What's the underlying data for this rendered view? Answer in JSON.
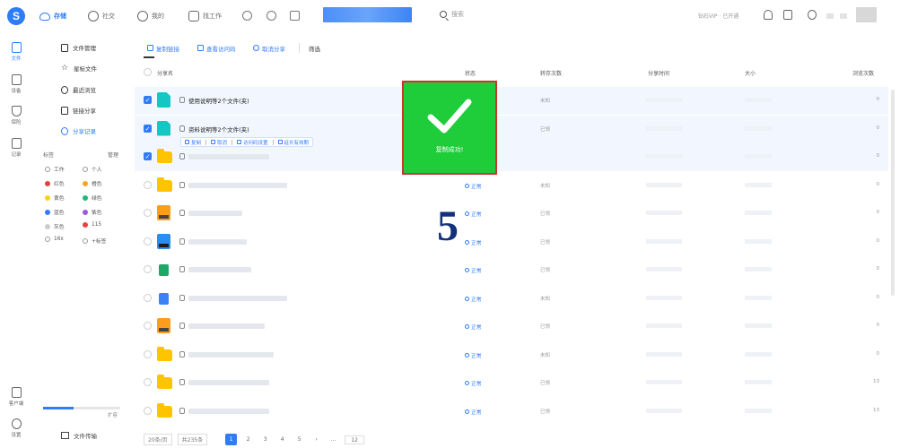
{
  "app": {
    "logo": "S",
    "nav": [
      {
        "label": "存储",
        "icon": "cloud-icon",
        "active": true
      },
      {
        "label": "社交",
        "icon": "clock-icon",
        "active": false
      },
      {
        "label": "我的",
        "icon": "heart-icon",
        "active": false
      },
      {
        "label": "找工作",
        "icon": "briefcase-icon",
        "active": false
      }
    ],
    "search_placeholder": "搜索",
    "vip_text": "钻石VIP · 已开通"
  },
  "rail": [
    {
      "label": "文件",
      "icon": "file-icon",
      "active": true
    },
    {
      "label": "设备",
      "icon": "device-icon",
      "active": false
    },
    {
      "label": "保险",
      "icon": "shield-icon",
      "active": false
    },
    {
      "label": "记录",
      "icon": "pen-icon",
      "active": false
    },
    {
      "label": "客户端",
      "icon": "download-icon",
      "active": false
    },
    {
      "label": "设置",
      "icon": "settings-icon",
      "active": false
    }
  ],
  "sidebar": {
    "items": [
      {
        "label": "文件管理",
        "icon": "file-manage-icon",
        "active": false
      },
      {
        "label": "星标文件",
        "icon": "star-icon",
        "active": false
      },
      {
        "label": "最近浏览",
        "icon": "clock-icon",
        "active": false
      },
      {
        "label": "链接分享",
        "icon": "share-icon",
        "active": false
      },
      {
        "label": "分享记录",
        "icon": "link-icon",
        "active": true
      }
    ],
    "tags_title": "标签",
    "tags_manage": "管理",
    "tags": [
      {
        "label": "工作",
        "color": "#999999",
        "hollow": true
      },
      {
        "label": "个人",
        "color": "#999999",
        "hollow": true
      },
      {
        "label": "红色",
        "color": "#e64340"
      },
      {
        "label": "橙色",
        "color": "#f5a623"
      },
      {
        "label": "黄色",
        "color": "#f8d21a"
      },
      {
        "label": "绿色",
        "color": "#1db977"
      },
      {
        "label": "蓝色",
        "color": "#2f7cf6"
      },
      {
        "label": "紫色",
        "color": "#9b59e0"
      },
      {
        "label": "灰色",
        "color": "#cccccc"
      },
      {
        "label": "115",
        "color": "#e64340"
      },
      {
        "label": "16x",
        "color": "#cccccc",
        "hollow": true
      },
      {
        "label": "+标签",
        "color": "#cccccc",
        "hollow": true
      }
    ],
    "storage_percent": 40,
    "storage_text": "扩容",
    "transfer": "文件传输"
  },
  "toolbar": {
    "buttons": [
      {
        "label": "复制链接",
        "icon": "copy-icon"
      },
      {
        "label": "查看访问码",
        "icon": "eye-icon"
      },
      {
        "label": "取消分享",
        "icon": "cancel-icon"
      },
      {
        "label": "筛选",
        "icon": "filter-icon"
      }
    ]
  },
  "table": {
    "headers": [
      "分享名",
      "状态",
      "转存次数",
      "分享时间",
      "大小",
      "浏览次数"
    ],
    "rows": [
      {
        "icon": "teal",
        "name": "使用说明等2个文件(夹)",
        "status": "",
        "copies": "未知",
        "views": "0",
        "selected": true
      },
      {
        "icon": "teal",
        "name": "资料说明等2个文件(夹)",
        "status": "",
        "copies": "已领",
        "views": "0",
        "selected": true
      },
      {
        "icon": "folder",
        "name": "",
        "status": "",
        "copies": "",
        "views": "0",
        "selected": true
      },
      {
        "icon": "folder",
        "name": "",
        "status": "正常",
        "copies": "未知",
        "views": "0",
        "selected": false
      },
      {
        "icon": "orange",
        "name": "",
        "status": "正常",
        "copies": "已领",
        "views": "0",
        "selected": false
      },
      {
        "icon": "sheet-blue",
        "name": "",
        "status": "正常",
        "copies": "已领",
        "views": "0",
        "selected": false
      },
      {
        "icon": "excel",
        "name": "",
        "status": "正常",
        "copies": "已领",
        "views": "0",
        "selected": false
      },
      {
        "icon": "doc",
        "name": "",
        "status": "正常",
        "copies": "未知",
        "views": "0",
        "selected": false
      },
      {
        "icon": "orange",
        "name": "",
        "status": "正常",
        "copies": "已领",
        "views": "0",
        "selected": false
      },
      {
        "icon": "folder",
        "name": "",
        "status": "正常",
        "copies": "未知",
        "views": "0",
        "selected": false
      },
      {
        "icon": "folder",
        "name": "",
        "status": "正常",
        "copies": "已领",
        "views": "13",
        "selected": false
      },
      {
        "icon": "folder",
        "name": "",
        "status": "正常",
        "copies": "已领",
        "views": "13",
        "selected": false
      }
    ],
    "row_actions": [
      "复制",
      "取消",
      "访问码设置",
      "延长有效期"
    ]
  },
  "overlay": {
    "message": "复制成功!",
    "badge": "5"
  },
  "pager": {
    "page_size": "20条/页",
    "total": "共235条",
    "pages": [
      "1",
      "2",
      "3",
      "4",
      "5"
    ],
    "ellipsis": "...",
    "last": "12"
  }
}
